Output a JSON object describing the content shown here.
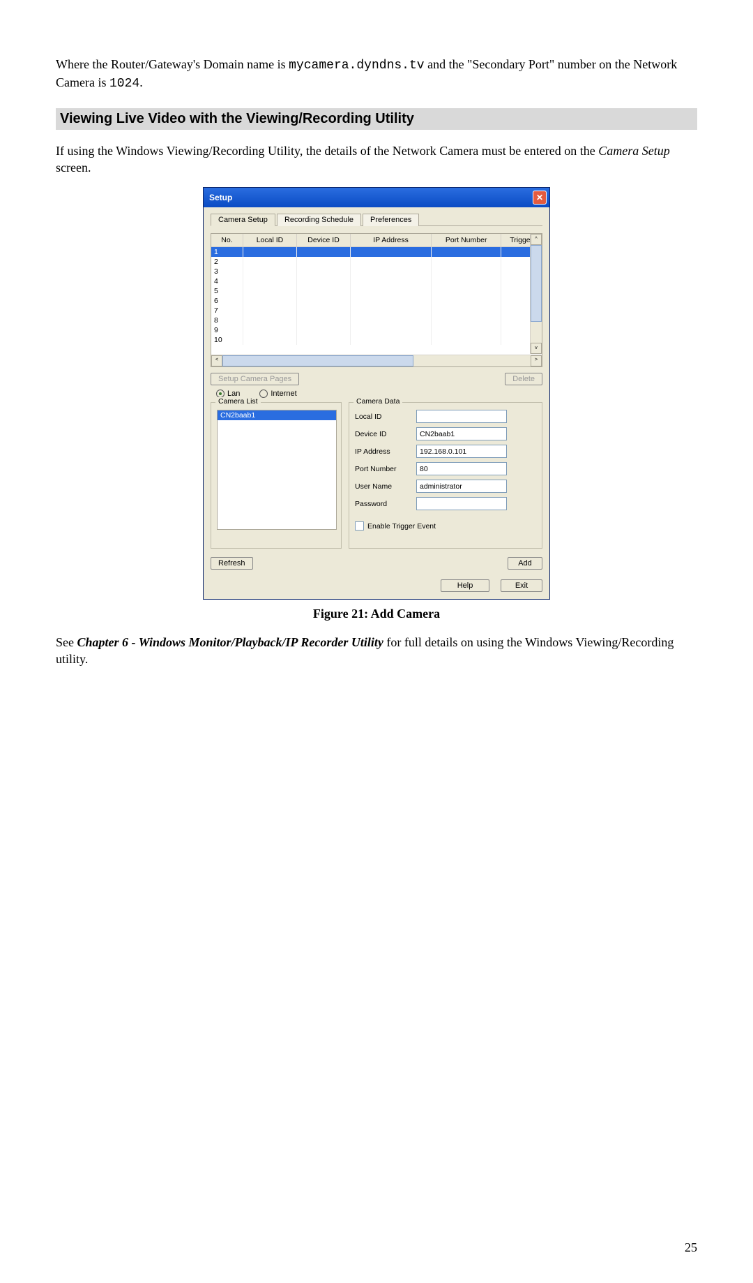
{
  "intro_part1": "Where the Router/Gateway's Domain name is ",
  "intro_domain": "mycamera.dyndns.tv",
  "intro_part2": " and the \"Secondary Port\" number on the Network Camera is ",
  "intro_port": "1024",
  "intro_part3": ".",
  "heading": "Viewing Live Video with the Viewing/Recording Utility",
  "para2_part1": "If using the Windows Viewing/Recording Utility, the details of the Network Camera must be entered on the ",
  "para2_italic": "Camera Setup",
  "para2_part2": " screen.",
  "dialog": {
    "title": "Setup",
    "tabs": [
      "Camera Setup",
      "Recording Schedule",
      "Preferences"
    ],
    "columns": [
      "No.",
      "Local ID",
      "Device ID",
      "IP Address",
      "Port Number",
      "Trigger"
    ],
    "rows": [
      "1",
      "2",
      "3",
      "4",
      "5",
      "6",
      "7",
      "8",
      "9",
      "10"
    ],
    "setup_pages_btn": "Setup Camera Pages",
    "delete_btn": "Delete",
    "radio_lan": "Lan",
    "radio_internet": "Internet",
    "camera_list_title": "Camera List",
    "camera_list_item": "CN2baab1",
    "camera_data_title": "Camera Data",
    "fields": {
      "local_id_label": "Local ID",
      "local_id_value": "",
      "device_id_label": "Device ID",
      "device_id_value": "CN2baab1",
      "ip_label": "IP Address",
      "ip_value": "192.168.0.101",
      "port_label": "Port Number",
      "port_value": "80",
      "user_label": "User Name",
      "user_value": "administrator",
      "pwd_label": "Password",
      "pwd_value": ""
    },
    "enable_trigger": "Enable Trigger Event",
    "refresh_btn": "Refresh",
    "add_btn": "Add",
    "help_btn": "Help",
    "exit_btn": "Exit"
  },
  "figure_caption": "Figure 21: Add Camera",
  "closing_part1": "See ",
  "closing_bold": "Chapter 6 - Windows Monitor/Playback/IP Recorder Utility",
  "closing_part2": " for full details on using the Windows Viewing/Recording utility.",
  "page_number": "25"
}
